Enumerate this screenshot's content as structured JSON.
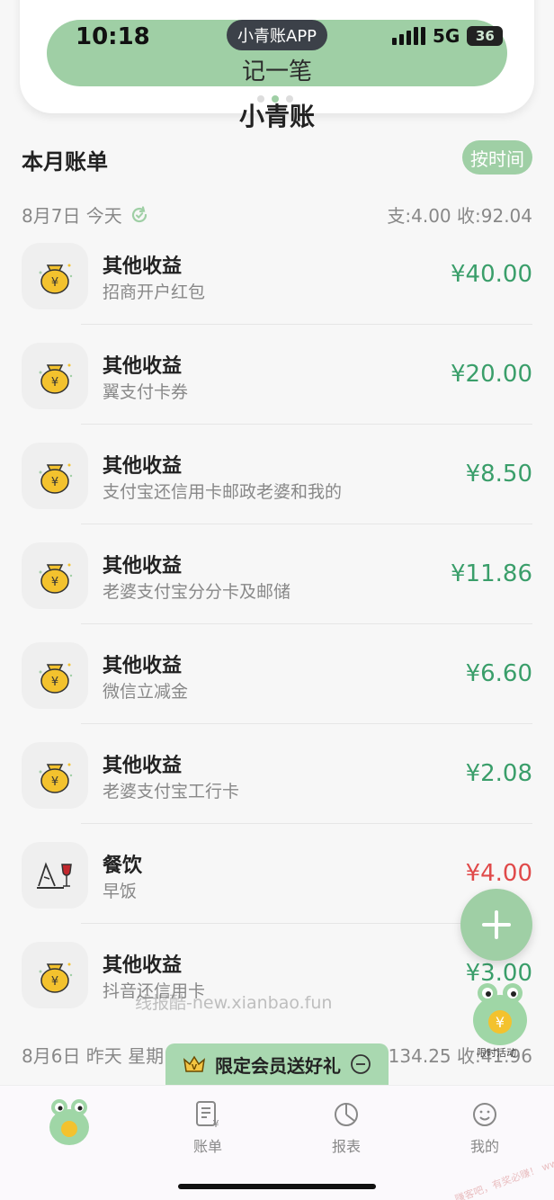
{
  "status_bar": {
    "time": "10:18",
    "pill_label": "小青账APP",
    "network": "5G",
    "battery": "36"
  },
  "header": {
    "record_button_label": "记一笔",
    "app_title": "小青账"
  },
  "section": {
    "title": "本月账单",
    "sort_label": "按时间"
  },
  "days": [
    {
      "date_label": "8月7日 今天",
      "totals": "支:4.00 收:92.04"
    },
    {
      "date_label": "8月6日 昨天 星期",
      "totals": "支:134.25 收:41.96"
    }
  ],
  "transactions": [
    {
      "category": "其他收益",
      "note": "招商开户红包",
      "amount": "¥40.00",
      "type": "income",
      "icon": "money-bag-icon"
    },
    {
      "category": "其他收益",
      "note": "翼支付卡券",
      "amount": "¥20.00",
      "type": "income",
      "icon": "money-bag-icon"
    },
    {
      "category": "其他收益",
      "note": "支付宝还信用卡邮政老婆和我的",
      "amount": "¥8.50",
      "type": "income",
      "icon": "money-bag-icon"
    },
    {
      "category": "其他收益",
      "note": "老婆支付宝分分卡及邮储",
      "amount": "¥11.86",
      "type": "income",
      "icon": "money-bag-icon"
    },
    {
      "category": "其他收益",
      "note": "微信立减金",
      "amount": "¥6.60",
      "type": "income",
      "icon": "money-bag-icon"
    },
    {
      "category": "其他收益",
      "note": "老婆支付宝工行卡",
      "amount": "¥2.08",
      "type": "income",
      "icon": "money-bag-icon"
    },
    {
      "category": "餐饮",
      "note": "早饭",
      "amount": "¥4.00",
      "type": "expense",
      "icon": "dining-icon"
    },
    {
      "category": "其他收益",
      "note": "抖音还信用卡",
      "amount": "¥3.00",
      "type": "income",
      "icon": "money-bag-icon"
    }
  ],
  "watermark": "线报酷-new.xianbao.fun",
  "promo": {
    "banner_label": "限定会员送好礼",
    "mascot_caption": "限时活动"
  },
  "tabbar": {
    "tabs": [
      {
        "label": "",
        "icon": "frog-mascot-icon"
      },
      {
        "label": "账单",
        "icon": "bill-icon"
      },
      {
        "label": "报表",
        "icon": "chart-icon"
      },
      {
        "label": "我的",
        "icon": "profile-icon"
      }
    ]
  },
  "corner_watermark": "赚客吧，有奖必赚！ www.zuanke8.com",
  "colors": {
    "accent": "#9fcfa5",
    "income": "#3a9e6a",
    "expense": "#e04a4a"
  }
}
